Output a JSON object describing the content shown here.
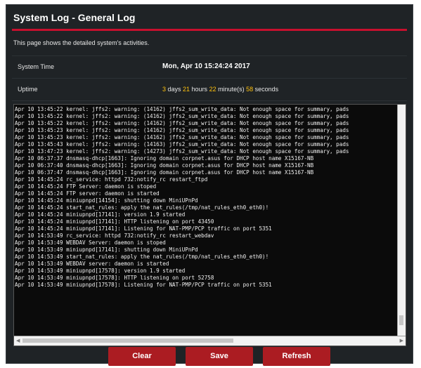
{
  "header": {
    "title": "System Log - General Log"
  },
  "description": "This page shows the detailed system's activities.",
  "info": {
    "system_time_label": "System Time",
    "system_time_value": "Mon, Apr 10 15:24:24 2017",
    "uptime_label": "Uptime",
    "uptime": {
      "days": "3",
      "days_unit": " days ",
      "hours": "21",
      "hours_unit": " hours ",
      "minutes": "22",
      "minutes_unit": " minute(s) ",
      "seconds": "58",
      "seconds_unit": " seconds"
    }
  },
  "log": {
    "lines": [
      "Apr 10 13:45:22 kernel: jffs2: warning: (14162) jffs2_sum_write_data: Not enough space for summary, pads",
      "Apr 10 13:45:22 kernel: jffs2: warning: (14162) jffs2_sum_write_data: Not enough space for summary, pads",
      "Apr 10 13:45:22 kernel: jffs2: warning: (14162) jffs2_sum_write_data: Not enough space for summary, pads",
      "Apr 10 13:45:23 kernel: jffs2: warning: (14162) jffs2_sum_write_data: Not enough space for summary, pads",
      "Apr 10 13:45:23 kernel: jffs2: warning: (14162) jffs2_sum_write_data: Not enough space for summary, pads",
      "Apr 10 13:45:43 kernel: jffs2: warning: (14163) jffs2_sum_write_data: Not enough space for summary, pads",
      "Apr 10 13:47:23 kernel: jffs2: warning: (14273) jffs2_sum_write_data: Not enough space for summary, pads",
      "Apr 10 06:37:37 dnsmasq-dhcp[1663]: Ignoring domain corpnet.asus for DHCP host name X15167-NB",
      "Apr 10 06:37:40 dnsmasq-dhcp[1663]: Ignoring domain corpnet.asus for DHCP host name X15167-NB",
      "Apr 10 06:37:47 dnsmasq-dhcp[1663]: Ignoring domain corpnet.asus for DHCP host name X15167-NB",
      "Apr 10 14:45:24 rc_service: httpd 732:notify_rc restart_ftpd",
      "Apr 10 14:45:24 FTP Server: daemon is stoped",
      "Apr 10 14:45:24 FTP server: daemon is started",
      "Apr 10 14:45:24 miniupnpd[14154]: shutting down MiniUPnPd",
      "Apr 10 14:45:24 start_nat_rules: apply the nat_rules(/tmp/nat_rules_eth0_eth0)!",
      "Apr 10 14:45:24 miniupnpd[17141]: version 1.9 started",
      "Apr 10 14:45:24 miniupnpd[17141]: HTTP listening on port 43450",
      "Apr 10 14:45:24 miniupnpd[17141]: Listening for NAT-PMP/PCP traffic on port 5351",
      "Apr 10 14:53:49 rc_service: httpd 732:notify_rc restart_webdav",
      "Apr 10 14:53:49 WEBDAV Server: daemon is stoped",
      "Apr 10 14:53:49 miniupnpd[17141]: shutting down MiniUPnPd",
      "Apr 10 14:53:49 start_nat_rules: apply the nat_rules(/tmp/nat_rules_eth0_eth0)!",
      "Apr 10 14:53:49 WEBDAV server: daemon is started",
      "Apr 10 14:53:49 miniupnpd[17578]: version 1.9 started",
      "Apr 10 14:53:49 miniupnpd[17578]: HTTP listening on port 52758",
      "Apr 10 14:53:49 miniupnpd[17578]: Listening for NAT-PMP/PCP traffic on port 5351"
    ]
  },
  "buttons": {
    "clear": "Clear",
    "save": "Save",
    "refresh": "Refresh"
  },
  "colors": {
    "accent": "#c8102e",
    "button": "#ab1c22",
    "highlight": "#ffc20e",
    "panel": "#1f2326"
  }
}
